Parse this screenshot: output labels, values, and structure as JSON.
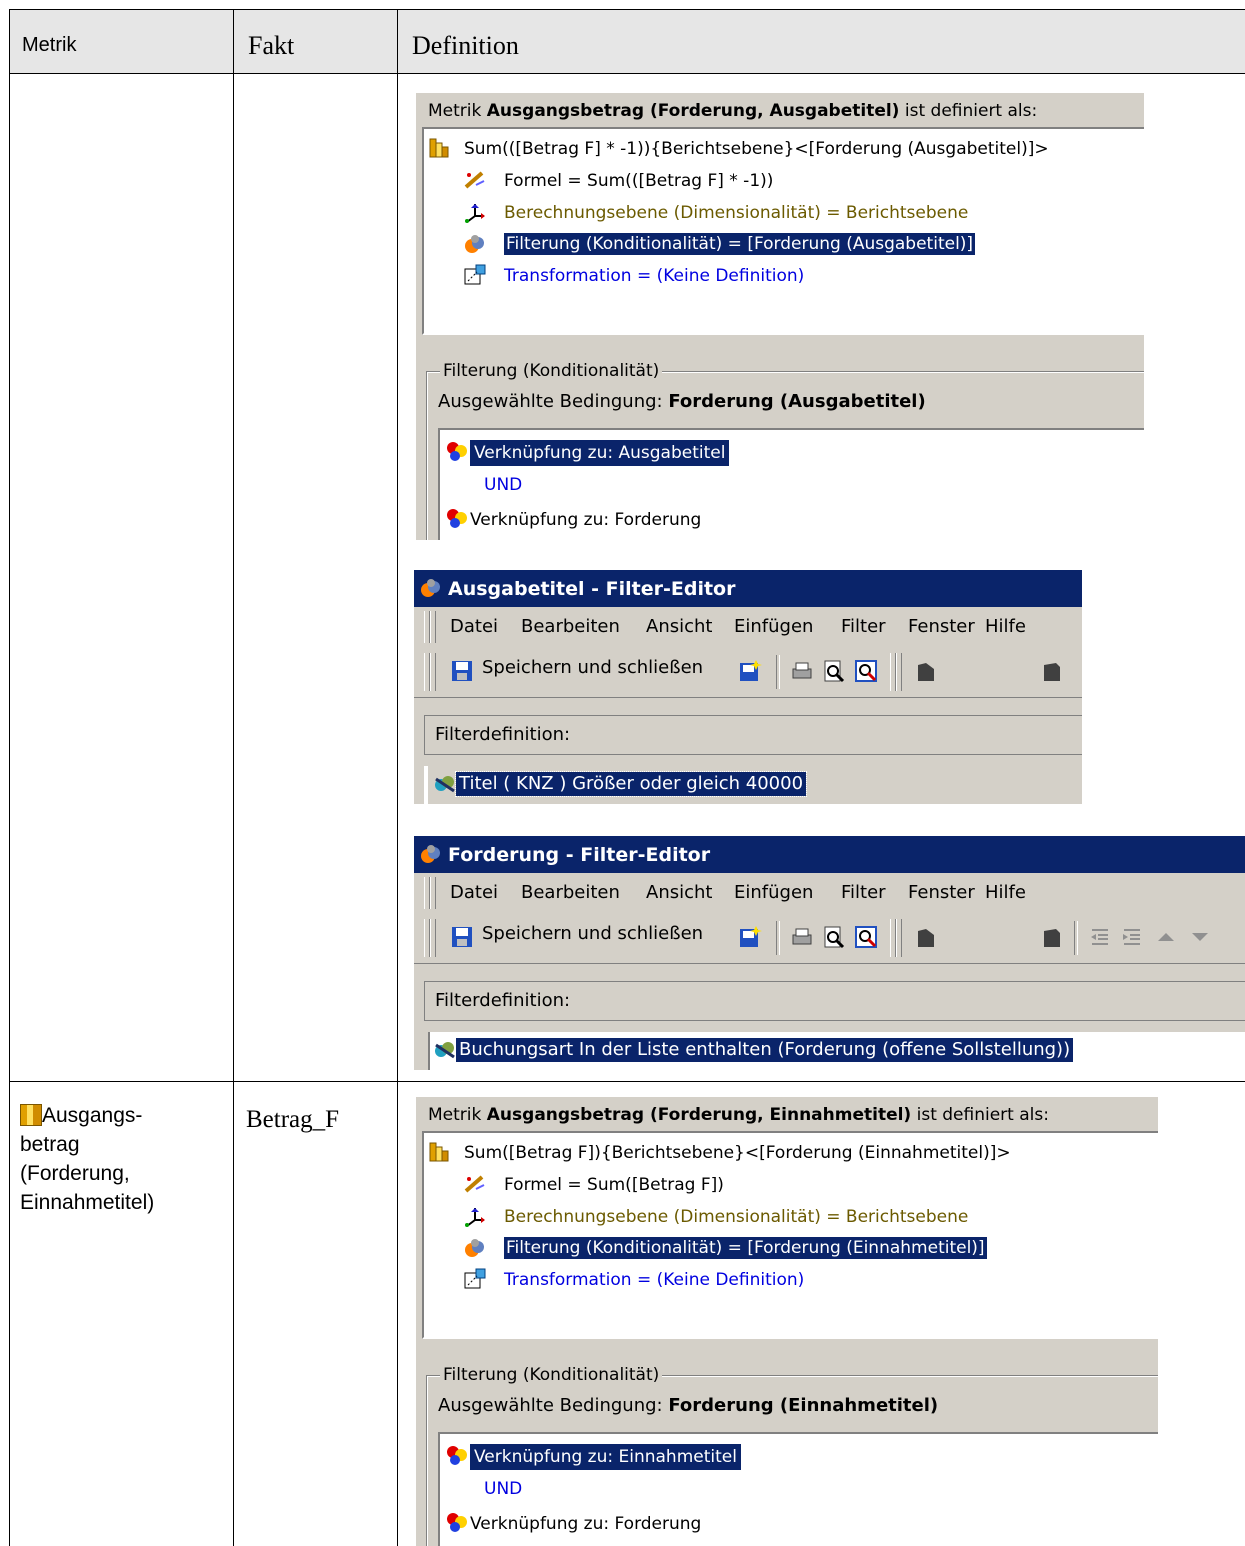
{
  "table": {
    "headers": {
      "metrik": "Metrik",
      "fakt": "Fakt",
      "definition": "Definition"
    },
    "row2": {
      "metric_lines": [
        "Ausgangs-",
        "betrag",
        "(Forderung,",
        "Einnahmetitel)"
      ],
      "fakt": "Betrag_F"
    }
  },
  "shot1": {
    "title_prefix": "Metrik",
    "title_bold": "Ausgangsbetrag (Forderung, Ausgabetitel)",
    "title_suffix": "ist definiert als:",
    "tree_root": "Sum(([Betrag F] * -1)){Berichtsebene}<[Forderung (Ausgabetitel)]>",
    "tree_formel": "Formel = Sum(([Betrag F] * -1))",
    "tree_berechnung": "Berechnungsebene (Dimensionalität) = Berichtsebene",
    "tree_filterung": "Filterung (Konditionalität) = [Forderung (Ausgabetitel)]",
    "tree_transformation": "Transformation = (Keine Definition)",
    "group_label": "Filterung (Konditionalität)",
    "cond_prefix": "Ausgewählte Bedingung:",
    "cond_bold": "Forderung (Ausgabetitel)",
    "cond_items": [
      "Verknüpfung zu: Ausgabetitel",
      "UND",
      "Verknüpfung zu: Forderung"
    ]
  },
  "shot2": {
    "title": "Ausgabetitel - Filter-Editor",
    "menu": [
      "Datei",
      "Bearbeiten",
      "Ansicht",
      "Einfügen",
      "Filter",
      "Fenster",
      "Hilfe"
    ],
    "save_label": "Speichern und schließen",
    "filterdef_label": "Filterdefinition:",
    "filter_item": "Titel ( KNZ )  Größer oder gleich 40000"
  },
  "shot3": {
    "title": "Forderung - Filter-Editor",
    "menu": [
      "Datei",
      "Bearbeiten",
      "Ansicht",
      "Einfügen",
      "Filter",
      "Fenster",
      "Hilfe"
    ],
    "save_label": "Speichern und schließen",
    "filterdef_label": "Filterdefinition:",
    "filter_item": "Buchungsart In der Liste enthalten (Forderung (offene Sollstellung))"
  },
  "shot4": {
    "title_prefix": "Metrik",
    "title_bold": "Ausgangsbetrag (Forderung, Einnahmetitel)",
    "title_suffix": "ist definiert als:",
    "tree_root": "Sum([Betrag F]){Berichtsebene}<[Forderung (Einnahmetitel)]>",
    "tree_formel": "Formel = Sum([Betrag F])",
    "tree_berechnung": "Berechnungsebene (Dimensionalität) = Berichtsebene",
    "tree_filterung": "Filterung (Konditionalität) = [Forderung (Einnahmetitel)]",
    "tree_transformation": "Transformation = (Keine Definition)",
    "group_label": "Filterung (Konditionalität)",
    "cond_prefix": "Ausgewählte Bedingung:",
    "cond_bold": "Forderung (Einnahmetitel)",
    "cond_items": [
      "Verknüpfung zu: Einnahmetitel",
      "UND",
      "Verknüpfung zu: Forderung"
    ]
  },
  "colors": {
    "selection": "#0a246a",
    "dialog": "#d4d0c8",
    "olive_text": "#6b5a00",
    "blue_text": "#0000e0"
  },
  "icons": [
    "metric-icon",
    "formula-icon",
    "dimension-icon",
    "filter-icon",
    "transformation-icon",
    "condition-icon",
    "save-icon",
    "new-icon",
    "print-icon",
    "preview-icon",
    "view-icon"
  ]
}
